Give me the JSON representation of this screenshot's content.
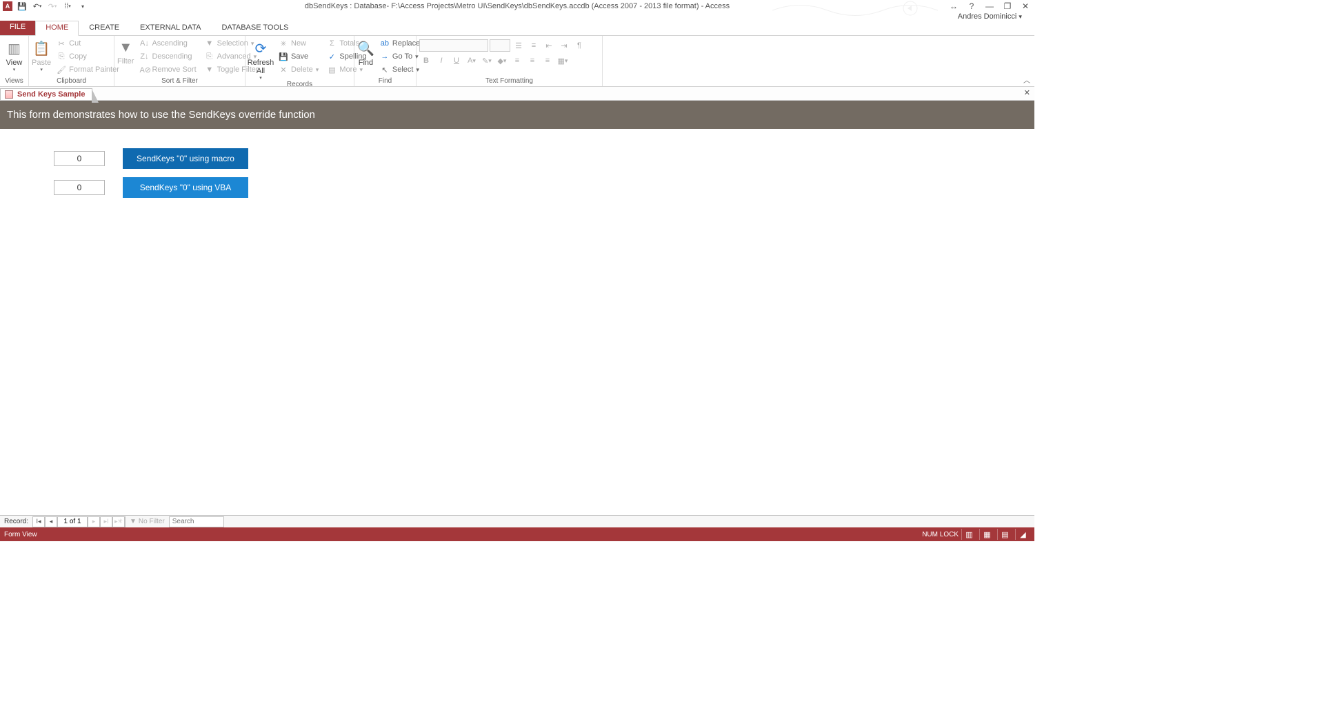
{
  "title": "dbSendKeys : Database- F:\\Access Projects\\Metro UI\\SendKeys\\dbSendKeys.accdb (Access 2007 - 2013 file format) - Access",
  "user": "Andres Dominicci",
  "tabs": {
    "file": "FILE",
    "home": "HOME",
    "create": "CREATE",
    "external": "EXTERNAL DATA",
    "dbtools": "DATABASE TOOLS"
  },
  "ribbon": {
    "views": {
      "label": "Views",
      "view": "View"
    },
    "clipboard": {
      "label": "Clipboard",
      "paste": "Paste",
      "cut": "Cut",
      "copy": "Copy",
      "format_painter": "Format Painter"
    },
    "sortfilter": {
      "label": "Sort & Filter",
      "filter": "Filter",
      "asc": "Ascending",
      "desc": "Descending",
      "remove": "Remove Sort",
      "selection": "Selection",
      "advanced": "Advanced",
      "toggle": "Toggle Filter"
    },
    "records": {
      "label": "Records",
      "refresh": "Refresh\nAll",
      "new": "New",
      "save": "Save",
      "delete": "Delete",
      "totals": "Totals",
      "spelling": "Spelling",
      "more": "More"
    },
    "find": {
      "label": "Find",
      "find": "Find",
      "replace": "Replace",
      "goto": "Go To",
      "select": "Select"
    },
    "textfmt": {
      "label": "Text Formatting"
    }
  },
  "doctab": {
    "name": "Send Keys Sample"
  },
  "form": {
    "header": "This form demonstrates how to use the SendKeys override function",
    "val1": "0",
    "val2": "0",
    "btn1": "SendKeys \"0\" using macro",
    "btn2": "SendKeys \"0\" using VBA"
  },
  "recnav": {
    "label": "Record:",
    "pos": "1 of 1",
    "nofilter": "No Filter",
    "search": "Search"
  },
  "status": {
    "left": "Form View",
    "numlock": "NUM LOCK"
  }
}
